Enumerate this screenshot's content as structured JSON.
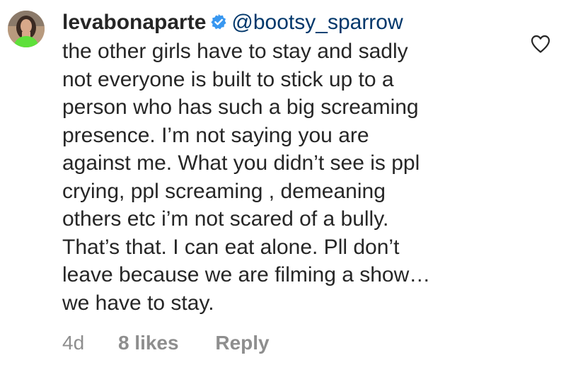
{
  "comment": {
    "username": "levabonaparte",
    "mention": "@bootsy_sparrow",
    "text_first_line": "the other girls have to stay and sadly",
    "text_lines": [
      "not everyone is built to stick up to a",
      "person who has such a big screaming",
      "presence. I’m not saying you are",
      "against me. What you didn’t see is ppl",
      "crying, ppl screaming , demeaning",
      "others etc i’m not scared of a bully.",
      "That’s that. I can eat alone. Pll don’t",
      "leave because we are filming a show…",
      "we have to stay."
    ],
    "time": "4d",
    "likes": "8 likes",
    "reply_label": "Reply"
  },
  "icons": {
    "avatar": "profile-photo",
    "verified": "verified-badge-icon",
    "like": "heart-outline-icon"
  },
  "colors": {
    "text": "#262626",
    "mention": "#00376b",
    "meta": "#8e8e8e",
    "verified": "#3897f0"
  }
}
